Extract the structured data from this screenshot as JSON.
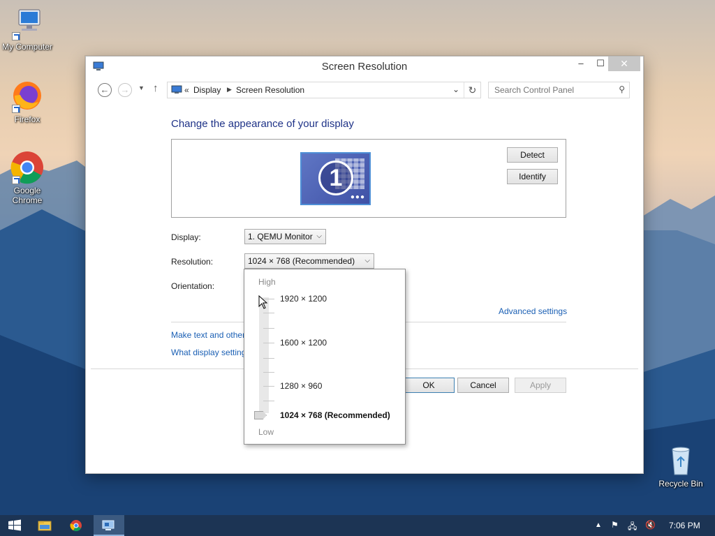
{
  "desktop": {
    "icons": [
      {
        "label": "My Computer",
        "icon": "computer-icon"
      },
      {
        "label": "Firefox",
        "icon": "firefox-icon"
      },
      {
        "label": "Google Chrome",
        "icon": "chrome-icon"
      },
      {
        "label": "Recycle Bin",
        "icon": "recycle-bin-icon"
      }
    ]
  },
  "window": {
    "title": "Screen Resolution",
    "controls": {
      "minimize": "–",
      "maximize": "☐",
      "close": "✕"
    }
  },
  "address": {
    "prefix": "«",
    "breadcrumbs": [
      "Display",
      "Screen Resolution"
    ],
    "search_placeholder": "Search Control Panel"
  },
  "content": {
    "heading": "Change the appearance of your display",
    "monitor_number": "1",
    "detect_label": "Detect",
    "identify_label": "Identify",
    "display_label": "Display:",
    "display_value": "1. QEMU Monitor",
    "resolution_label": "Resolution:",
    "resolution_value": "1024 × 768 (Recommended)",
    "orientation_label": "Orientation:",
    "advanced_link": "Advanced settings",
    "link_text_size": "Make text and other",
    "link_display_settings": "What display setting",
    "ok_label": "OK",
    "cancel_label": "Cancel",
    "apply_label": "Apply"
  },
  "resolution_dropdown": {
    "high_label": "High",
    "low_label": "Low",
    "options": [
      "1920 × 1200",
      "1600 × 1200",
      "1280 × 960",
      "1024 × 768 (Recommended)"
    ],
    "selected": "1024 × 768 (Recommended)"
  },
  "taskbar": {
    "items": [
      "start-icon",
      "file-explorer-icon",
      "chrome-icon",
      "screen-resolution-icon"
    ],
    "tray": [
      "show-hidden-icons",
      "action-center-flag-icon",
      "network-icon",
      "volume-muted-icon"
    ],
    "clock": "7:06 PM"
  }
}
